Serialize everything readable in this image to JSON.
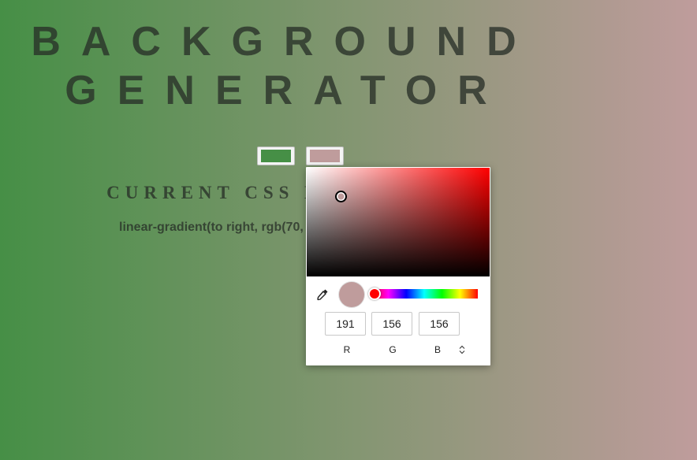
{
  "title": {
    "line1": "BACKGROUND",
    "line2": "GENERATOR"
  },
  "color_inputs": {
    "color1": "#468f46",
    "color2": "#bf9c9c"
  },
  "heading": "CURRENT CSS BACKGROUND",
  "css_output": "linear-gradient(to right, rgb(70,",
  "picker": {
    "selected_color": "#bf9c9c",
    "hue_color": "#ff0000",
    "hue_level": 0,
    "rgb": {
      "r": "191",
      "g": "156",
      "b": "156"
    },
    "labels": {
      "r": "R",
      "g": "G",
      "b": "B"
    },
    "icons": {
      "eyedropper": "eyedropper-icon",
      "mode_toggle": "chevron-up-down-icon"
    }
  }
}
